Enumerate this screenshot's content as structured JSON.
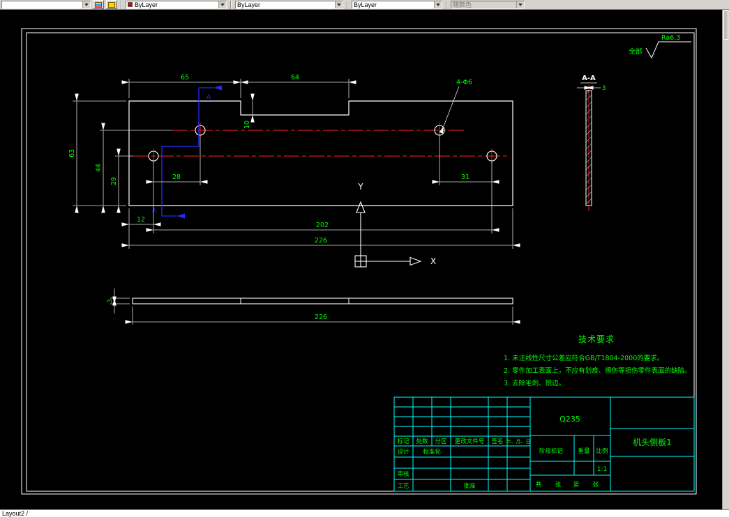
{
  "toolbar": {
    "layer_value": "",
    "color_value": "ByLayer",
    "linetype_value": "ByLayer",
    "lineweight_value": "ByLayer",
    "plotstyle_value": "随颜色"
  },
  "statusbar": {
    "tab_label": "Layout2 /"
  },
  "colors": {
    "canvas_background": "#000000",
    "object_lines": "#ffffff",
    "center_lines": "#ff2222",
    "dimension_text": "#00ff00",
    "section_cut_line": "#2a2aff",
    "title_block_lines": "#00ffff"
  },
  "drawing": {
    "dims": {
      "d65": "65",
      "d64": "64",
      "d10": "10",
      "d63": "63",
      "d44": "44",
      "d29": "29",
      "d28": "28",
      "d31": "31",
      "d12": "12",
      "d202": "202",
      "d226_front": "226",
      "d226_bottom": "226",
      "d3_bottom": "3",
      "d3_section": "3"
    },
    "labels": {
      "hole_note": "4-Φ6",
      "section_name": "A-A",
      "section_mark": "A",
      "axis_x": "X",
      "axis_y": "Y",
      "finish_scope": "全部",
      "finish_value": "Ra6.3"
    },
    "tech_requirements": {
      "title": "技术要求",
      "items": [
        "1. 未注线性尺寸公差应符合GB/T1804-2000的要求。",
        "2. 零件加工表面上，不应有划痕、擦伤等损伤零件表面的缺陷。",
        "3. 去除毛刺、锐边。"
      ]
    },
    "title_block": {
      "material": "Q235",
      "part_name": "机头侧板1",
      "rev_headers": [
        "标记",
        "处数",
        "分区",
        "更改文件号",
        "签名",
        "年、月、日"
      ],
      "design_label": "设计",
      "standardization_label": "标准化",
      "audit_label": "审核",
      "process_label": "工艺",
      "approve_label": "批准",
      "stage_label": "阶段标记",
      "weight_label": "重量",
      "scale_label": "比例",
      "scale_value": "1:1",
      "sheet_labels": [
        "共",
        "张",
        "第",
        "张"
      ]
    }
  }
}
